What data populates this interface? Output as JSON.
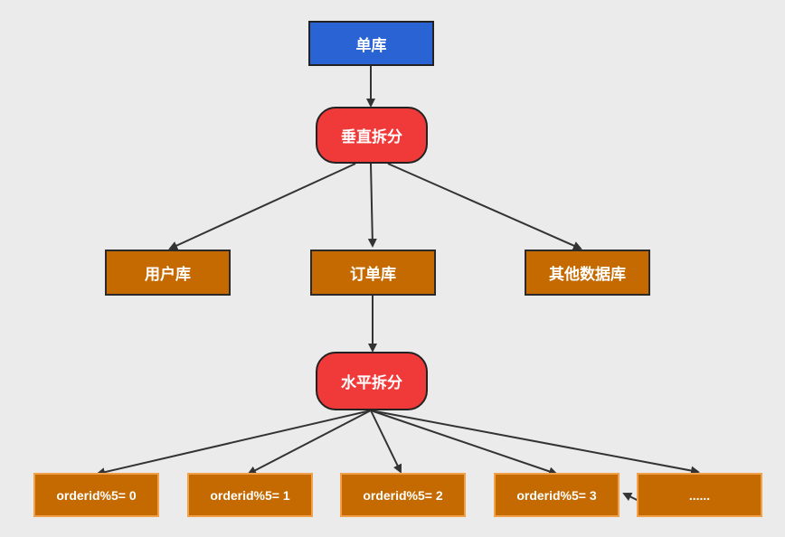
{
  "nodes": {
    "single_db": "单库",
    "vertical_split": "垂直拆分",
    "user_db": "用户库",
    "order_db": "订单库",
    "other_db": "其他数据库",
    "horizontal_split": "水平拆分",
    "shards": [
      "orderid%5= 0",
      "orderid%5= 1",
      "orderid%5= 2",
      "orderid%5= 3",
      "......"
    ]
  },
  "colors": {
    "root": "#2a63d3",
    "split": "#f03a3a",
    "database": "#c46a00",
    "shard_border": "#f0a14a",
    "arrow": "#333333"
  }
}
